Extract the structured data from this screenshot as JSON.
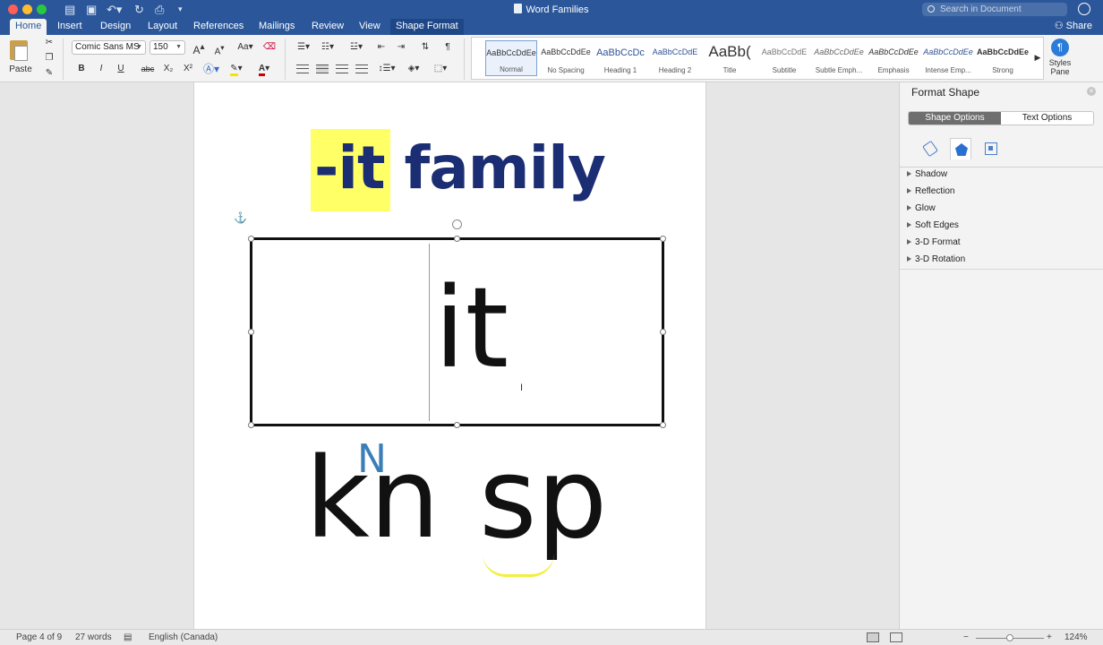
{
  "window": {
    "doc_title": "Word Families",
    "search_placeholder": "Search in Document"
  },
  "tabs": [
    "Home",
    "Insert",
    "Design",
    "Layout",
    "References",
    "Mailings",
    "Review",
    "View",
    "Shape Format"
  ],
  "active_tab": "Home",
  "share_label": "Share",
  "ribbon": {
    "paste_label": "Paste",
    "font_name": "Comic Sans MS",
    "font_size": "150",
    "bold": "B",
    "italic": "I",
    "underline": "U",
    "strike": "abc",
    "subscript": "X₂",
    "superscript": "X²",
    "grow": "A",
    "shrink": "A",
    "change_case": "Aa",
    "styles": [
      {
        "preview": "AaBbCcDdEe",
        "name": "Normal"
      },
      {
        "preview": "AaBbCcDdEe",
        "name": "No Spacing"
      },
      {
        "preview": "AaBbCcDc",
        "name": "Heading 1"
      },
      {
        "preview": "AaBbCcDdE",
        "name": "Heading 2"
      },
      {
        "preview": "AaBb(",
        "name": "Title"
      },
      {
        "preview": "AaBbCcDdE",
        "name": "Subtitle"
      },
      {
        "preview": "AaBbCcDdEe",
        "name": "Subtle Emph..."
      },
      {
        "preview": "AaBbCcDdEe",
        "name": "Emphasis"
      },
      {
        "preview": "AaBbCcDdEe",
        "name": "Intense Emp..."
      },
      {
        "preview": "AaBbCcDdEe",
        "name": "Strong"
      }
    ],
    "styles_pane_label": "Styles Pane"
  },
  "document": {
    "title_highlight": "-it",
    "title_rest": " family",
    "textbox_word": "it",
    "ink_word_1": "kn",
    "ink_word_2": "sp",
    "ink_correction": "N"
  },
  "format_pane": {
    "title": "Format Shape",
    "tabs": [
      "Shape Options",
      "Text Options"
    ],
    "sections": [
      "Shadow",
      "Reflection",
      "Glow",
      "Soft Edges",
      "3-D Format",
      "3-D Rotation"
    ]
  },
  "status": {
    "page": "Page 4 of 9",
    "words": "27 words",
    "language": "English (Canada)",
    "zoom": "124%"
  },
  "colors": {
    "title_blue": "#1b2e73",
    "highlight_yellow": "#ffff66",
    "ribbon_blue": "#2b579a"
  }
}
